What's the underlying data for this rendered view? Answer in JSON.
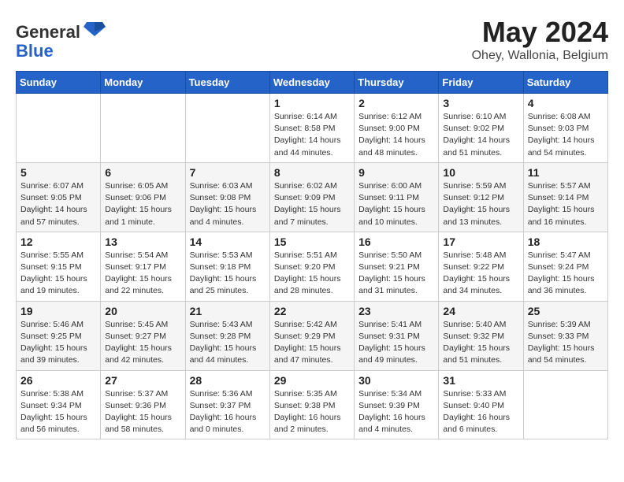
{
  "header": {
    "logo_general": "General",
    "logo_blue": "Blue",
    "month": "May 2024",
    "location": "Ohey, Wallonia, Belgium"
  },
  "days_of_week": [
    "Sunday",
    "Monday",
    "Tuesday",
    "Wednesday",
    "Thursday",
    "Friday",
    "Saturday"
  ],
  "weeks": [
    [
      {
        "day": "",
        "info": ""
      },
      {
        "day": "",
        "info": ""
      },
      {
        "day": "",
        "info": ""
      },
      {
        "day": "1",
        "info": "Sunrise: 6:14 AM\nSunset: 8:58 PM\nDaylight: 14 hours\nand 44 minutes."
      },
      {
        "day": "2",
        "info": "Sunrise: 6:12 AM\nSunset: 9:00 PM\nDaylight: 14 hours\nand 48 minutes."
      },
      {
        "day": "3",
        "info": "Sunrise: 6:10 AM\nSunset: 9:02 PM\nDaylight: 14 hours\nand 51 minutes."
      },
      {
        "day": "4",
        "info": "Sunrise: 6:08 AM\nSunset: 9:03 PM\nDaylight: 14 hours\nand 54 minutes."
      }
    ],
    [
      {
        "day": "5",
        "info": "Sunrise: 6:07 AM\nSunset: 9:05 PM\nDaylight: 14 hours\nand 57 minutes."
      },
      {
        "day": "6",
        "info": "Sunrise: 6:05 AM\nSunset: 9:06 PM\nDaylight: 15 hours\nand 1 minute."
      },
      {
        "day": "7",
        "info": "Sunrise: 6:03 AM\nSunset: 9:08 PM\nDaylight: 15 hours\nand 4 minutes."
      },
      {
        "day": "8",
        "info": "Sunrise: 6:02 AM\nSunset: 9:09 PM\nDaylight: 15 hours\nand 7 minutes."
      },
      {
        "day": "9",
        "info": "Sunrise: 6:00 AM\nSunset: 9:11 PM\nDaylight: 15 hours\nand 10 minutes."
      },
      {
        "day": "10",
        "info": "Sunrise: 5:59 AM\nSunset: 9:12 PM\nDaylight: 15 hours\nand 13 minutes."
      },
      {
        "day": "11",
        "info": "Sunrise: 5:57 AM\nSunset: 9:14 PM\nDaylight: 15 hours\nand 16 minutes."
      }
    ],
    [
      {
        "day": "12",
        "info": "Sunrise: 5:55 AM\nSunset: 9:15 PM\nDaylight: 15 hours\nand 19 minutes."
      },
      {
        "day": "13",
        "info": "Sunrise: 5:54 AM\nSunset: 9:17 PM\nDaylight: 15 hours\nand 22 minutes."
      },
      {
        "day": "14",
        "info": "Sunrise: 5:53 AM\nSunset: 9:18 PM\nDaylight: 15 hours\nand 25 minutes."
      },
      {
        "day": "15",
        "info": "Sunrise: 5:51 AM\nSunset: 9:20 PM\nDaylight: 15 hours\nand 28 minutes."
      },
      {
        "day": "16",
        "info": "Sunrise: 5:50 AM\nSunset: 9:21 PM\nDaylight: 15 hours\nand 31 minutes."
      },
      {
        "day": "17",
        "info": "Sunrise: 5:48 AM\nSunset: 9:22 PM\nDaylight: 15 hours\nand 34 minutes."
      },
      {
        "day": "18",
        "info": "Sunrise: 5:47 AM\nSunset: 9:24 PM\nDaylight: 15 hours\nand 36 minutes."
      }
    ],
    [
      {
        "day": "19",
        "info": "Sunrise: 5:46 AM\nSunset: 9:25 PM\nDaylight: 15 hours\nand 39 minutes."
      },
      {
        "day": "20",
        "info": "Sunrise: 5:45 AM\nSunset: 9:27 PM\nDaylight: 15 hours\nand 42 minutes."
      },
      {
        "day": "21",
        "info": "Sunrise: 5:43 AM\nSunset: 9:28 PM\nDaylight: 15 hours\nand 44 minutes."
      },
      {
        "day": "22",
        "info": "Sunrise: 5:42 AM\nSunset: 9:29 PM\nDaylight: 15 hours\nand 47 minutes."
      },
      {
        "day": "23",
        "info": "Sunrise: 5:41 AM\nSunset: 9:31 PM\nDaylight: 15 hours\nand 49 minutes."
      },
      {
        "day": "24",
        "info": "Sunrise: 5:40 AM\nSunset: 9:32 PM\nDaylight: 15 hours\nand 51 minutes."
      },
      {
        "day": "25",
        "info": "Sunrise: 5:39 AM\nSunset: 9:33 PM\nDaylight: 15 hours\nand 54 minutes."
      }
    ],
    [
      {
        "day": "26",
        "info": "Sunrise: 5:38 AM\nSunset: 9:34 PM\nDaylight: 15 hours\nand 56 minutes."
      },
      {
        "day": "27",
        "info": "Sunrise: 5:37 AM\nSunset: 9:36 PM\nDaylight: 15 hours\nand 58 minutes."
      },
      {
        "day": "28",
        "info": "Sunrise: 5:36 AM\nSunset: 9:37 PM\nDaylight: 16 hours\nand 0 minutes."
      },
      {
        "day": "29",
        "info": "Sunrise: 5:35 AM\nSunset: 9:38 PM\nDaylight: 16 hours\nand 2 minutes."
      },
      {
        "day": "30",
        "info": "Sunrise: 5:34 AM\nSunset: 9:39 PM\nDaylight: 16 hours\nand 4 minutes."
      },
      {
        "day": "31",
        "info": "Sunrise: 5:33 AM\nSunset: 9:40 PM\nDaylight: 16 hours\nand 6 minutes."
      },
      {
        "day": "",
        "info": ""
      }
    ]
  ]
}
